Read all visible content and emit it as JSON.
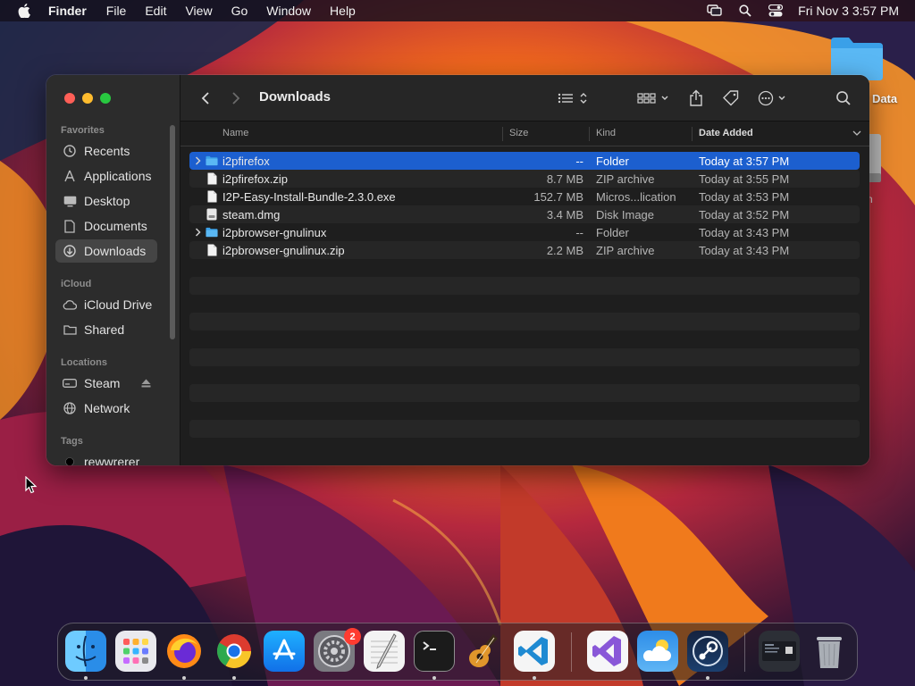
{
  "menubar": {
    "app_name": "Finder",
    "menus": [
      "File",
      "Edit",
      "View",
      "Go",
      "Window",
      "Help"
    ],
    "clock": "Fri Nov 3  3:57 PM",
    "status_icons": [
      "screen-mirroring-icon",
      "spotlight-search-icon",
      "control-center-icon"
    ]
  },
  "desktop": {
    "folder_label": "t Data",
    "drive_label": "n"
  },
  "finder": {
    "title": "Downloads",
    "sidebar": {
      "favorites_header": "Favorites",
      "favorites": [
        {
          "label": "Recents",
          "icon": "clock-icon"
        },
        {
          "label": "Applications",
          "icon": "applications-icon"
        },
        {
          "label": "Desktop",
          "icon": "desktop-icon"
        },
        {
          "label": "Documents",
          "icon": "document-icon"
        },
        {
          "label": "Downloads",
          "icon": "download-icon",
          "selected": true
        }
      ],
      "icloud_header": "iCloud",
      "icloud": [
        {
          "label": "iCloud Drive",
          "icon": "cloud-icon"
        },
        {
          "label": "Shared",
          "icon": "shared-folder-icon"
        }
      ],
      "locations_header": "Locations",
      "locations": [
        {
          "label": "Steam",
          "icon": "drive-icon"
        },
        {
          "label": "Network",
          "icon": "network-globe-icon"
        }
      ],
      "tags_header": "Tags",
      "tags": [
        {
          "label": "rewwrerer",
          "color": "#000000"
        }
      ]
    },
    "columns": {
      "name": "Name",
      "size": "Size",
      "kind": "Kind",
      "date_added": "Date Added"
    },
    "files": [
      {
        "name": "i2pfirefox",
        "size": "--",
        "kind": "Folder",
        "date": "Today at 3:57 PM",
        "type": "folder",
        "selected": true
      },
      {
        "name": "i2pfirefox.zip",
        "size": "8.7 MB",
        "kind": "ZIP archive",
        "date": "Today at 3:55 PM",
        "type": "file"
      },
      {
        "name": "I2P-Easy-Install-Bundle-2.3.0.exe",
        "size": "152.7 MB",
        "kind": "Micros...lication",
        "date": "Today at 3:53 PM",
        "type": "file"
      },
      {
        "name": "steam.dmg",
        "size": "3.4 MB",
        "kind": "Disk Image",
        "date": "Today at 3:52 PM",
        "type": "disk"
      },
      {
        "name": "i2pbrowser-gnulinux",
        "size": "--",
        "kind": "Folder",
        "date": "Today at 3:43 PM",
        "type": "folder"
      },
      {
        "name": "i2pbrowser-gnulinux.zip",
        "size": "2.2 MB",
        "kind": "ZIP archive",
        "date": "Today at 3:43 PM",
        "type": "file"
      }
    ]
  },
  "dock": {
    "apps": [
      "Finder",
      "Launchpad",
      "Firefox",
      "Chrome",
      "App Store",
      "System Settings",
      "TextEdit",
      "Terminal",
      "GarageBand",
      "Visual Studio Code",
      "Visual Studio",
      "Weather",
      "Steam",
      "Downloads Stack",
      "Trash"
    ],
    "settings_badge": "2"
  },
  "colors": {
    "accent": "#1c5fcf",
    "folder_blue": "#3aa0e8",
    "close": "#ff5f57",
    "minimize": "#febc2e",
    "maximize": "#28c840"
  }
}
